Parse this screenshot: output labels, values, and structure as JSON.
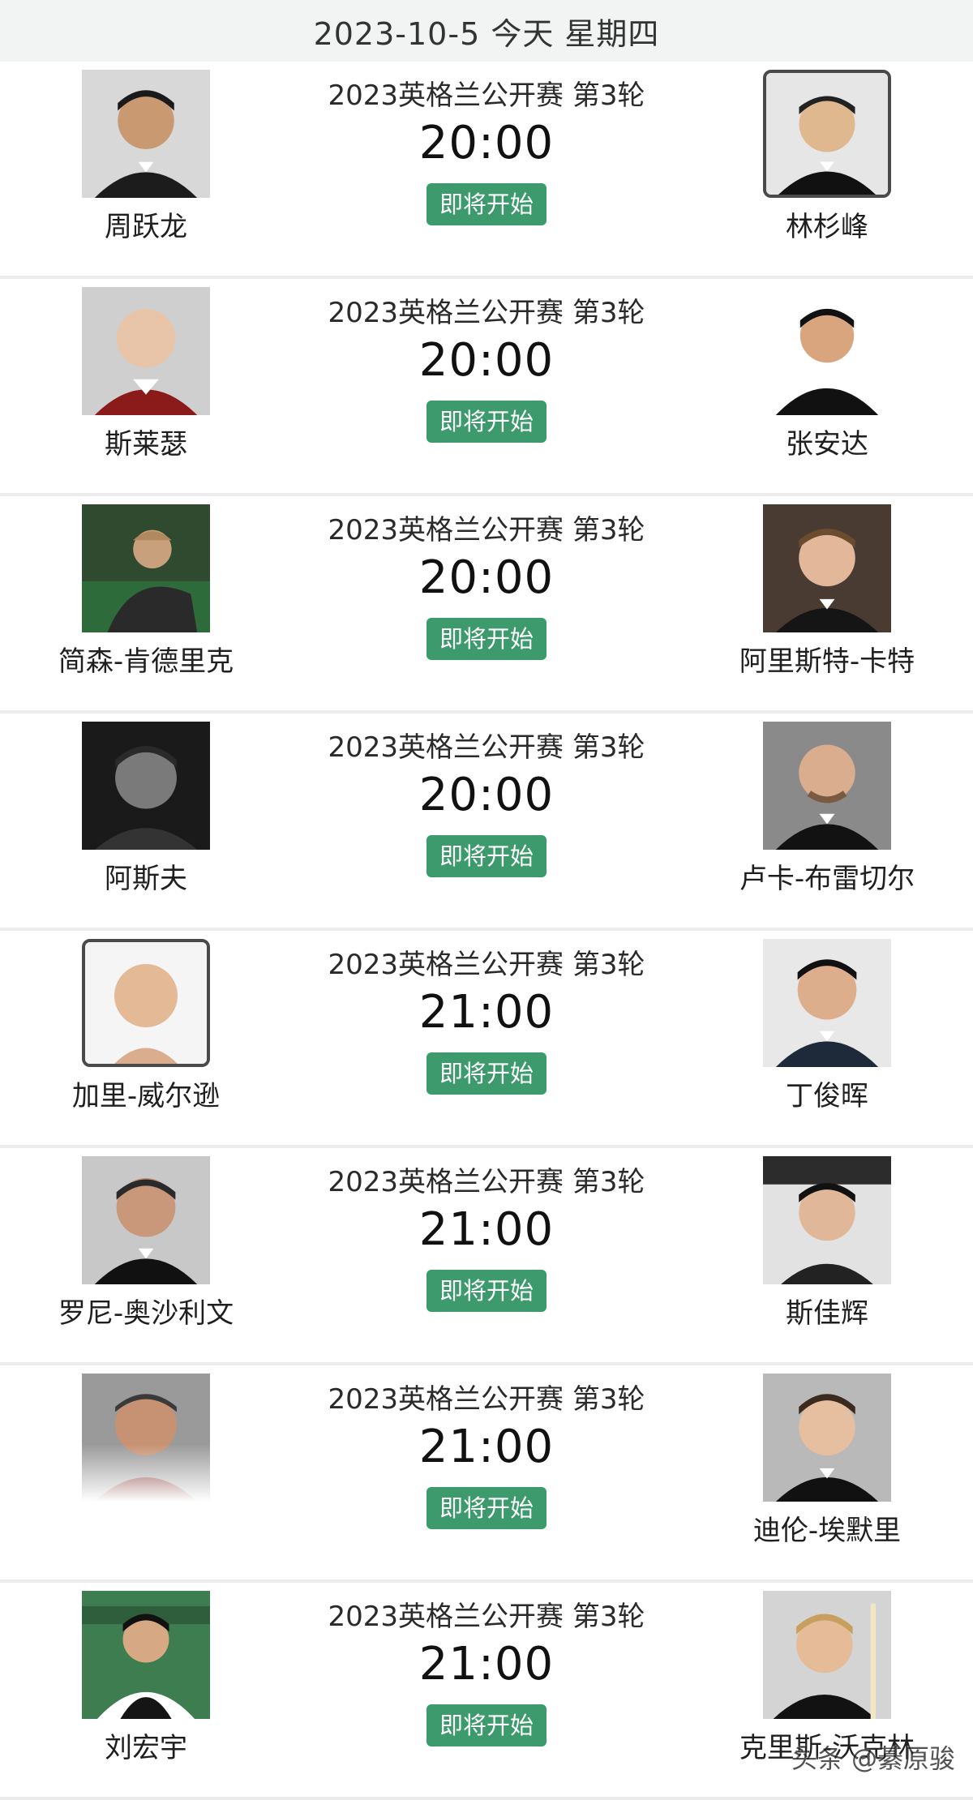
{
  "header": {
    "date": "2023-10-5 今天 星期四"
  },
  "status_label": "即将开始",
  "matches": [
    {
      "tournament": "2023英格兰公开赛 第3轮",
      "time": "20:00",
      "home": "周跃龙",
      "away": "林杉峰"
    },
    {
      "tournament": "2023英格兰公开赛 第3轮",
      "time": "20:00",
      "home": "斯莱瑟",
      "away": "张安达"
    },
    {
      "tournament": "2023英格兰公开赛 第3轮",
      "time": "20:00",
      "home": "简森-肯德里克",
      "away": "阿里斯特-卡特"
    },
    {
      "tournament": "2023英格兰公开赛 第3轮",
      "time": "20:00",
      "home": "阿斯夫",
      "away": "卢卡-布雷切尔"
    },
    {
      "tournament": "2023英格兰公开赛 第3轮",
      "time": "21:00",
      "home": "加里-威尔逊",
      "away": "丁俊晖"
    },
    {
      "tournament": "2023英格兰公开赛 第3轮",
      "time": "21:00",
      "home": "罗尼-奥沙利文",
      "away": "斯佳辉"
    },
    {
      "tournament": "2023英格兰公开赛 第3轮",
      "time": "21:00",
      "home": "",
      "away": "迪伦-埃默里"
    },
    {
      "tournament": "2023英格兰公开赛 第3轮",
      "time": "21:00",
      "home": "刘宏宇",
      "away": "克里斯-沃克林"
    }
  ],
  "watermark": "头条 @綦原骏",
  "colors": {
    "status_green": "#3d9a6c",
    "header_bg": "#f2f4f3",
    "divider": "#ebebeb"
  }
}
